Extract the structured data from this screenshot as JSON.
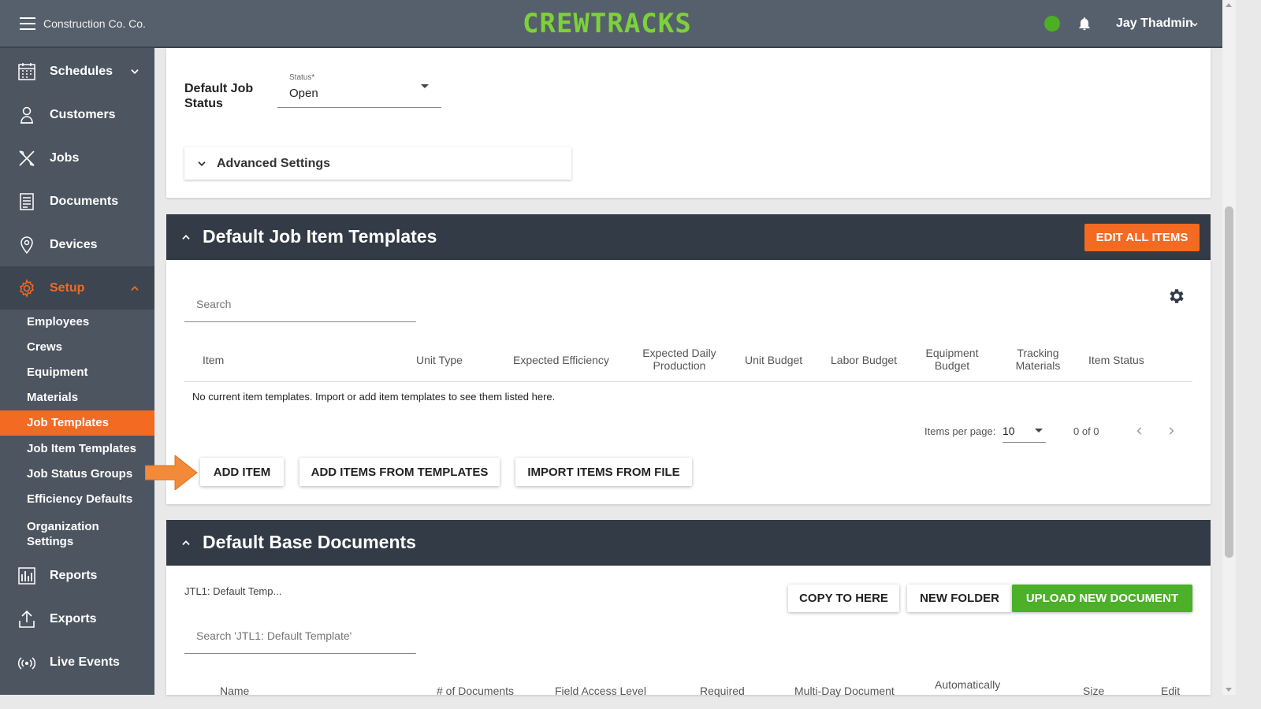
{
  "header": {
    "company": "Construction Co. Co.",
    "logo": "CREWTRACKS",
    "user": "Jay Thadmin",
    "status_color": "#4caf24"
  },
  "sidebar": {
    "items": [
      {
        "label": "Schedules",
        "icon": "calendar-icon"
      },
      {
        "label": "Customers",
        "icon": "person-icon"
      },
      {
        "label": "Jobs",
        "icon": "tools-icon"
      },
      {
        "label": "Documents",
        "icon": "document-icon"
      },
      {
        "label": "Devices",
        "icon": "location-pin-icon"
      },
      {
        "label": "Setup",
        "icon": "gear-icon"
      },
      {
        "label": "Reports",
        "icon": "bar-chart-icon"
      },
      {
        "label": "Exports",
        "icon": "upload-icon"
      },
      {
        "label": "Live Events",
        "icon": "broadcast-icon"
      }
    ],
    "setup_items": [
      "Employees",
      "Crews",
      "Equipment",
      "Materials",
      "Job Templates",
      "Job Item Templates",
      "Job Status Groups",
      "Efficiency Defaults",
      "Organization Settings"
    ],
    "accent": "#f36a22"
  },
  "settings": {
    "default_job_status_label": "Default Job Status",
    "status_field_label": "Status*",
    "status_value": "Open",
    "advanced_settings": "Advanced Settings"
  },
  "item_templates": {
    "title": "Default Job Item Templates",
    "edit_all": "EDIT ALL ITEMS",
    "search_placeholder": "Search",
    "columns": [
      "Item",
      "Unit Type",
      "Expected Efficiency",
      "Expected Daily Production",
      "Unit Budget",
      "Labor Budget",
      "Equipment Budget",
      "Tracking Materials",
      "Item Status"
    ],
    "empty_message": "No current item templates. Import or add item templates to see them listed here.",
    "items_per_page_label": "Items per page:",
    "items_per_page": "10",
    "range": "0 of 0",
    "buttons": {
      "add_item": "ADD ITEM",
      "add_from_templates": "ADD ITEMS FROM TEMPLATES",
      "import_from_file": "IMPORT ITEMS FROM FILE"
    }
  },
  "base_documents": {
    "title": "Default Base Documents",
    "breadcrumb": "JTL1: Default Temp...",
    "copy_to_here": "COPY TO HERE",
    "new_folder": "NEW FOLDER",
    "upload": "UPLOAD NEW DOCUMENT",
    "search_placeholder": "Search 'JTL1: Default Template'",
    "columns": [
      "Name",
      "# of Documents",
      "Field Access Level",
      "Required",
      "Multi-Day Document",
      "Automatically",
      "Size",
      "Edit"
    ],
    "green": "#4cb028"
  }
}
